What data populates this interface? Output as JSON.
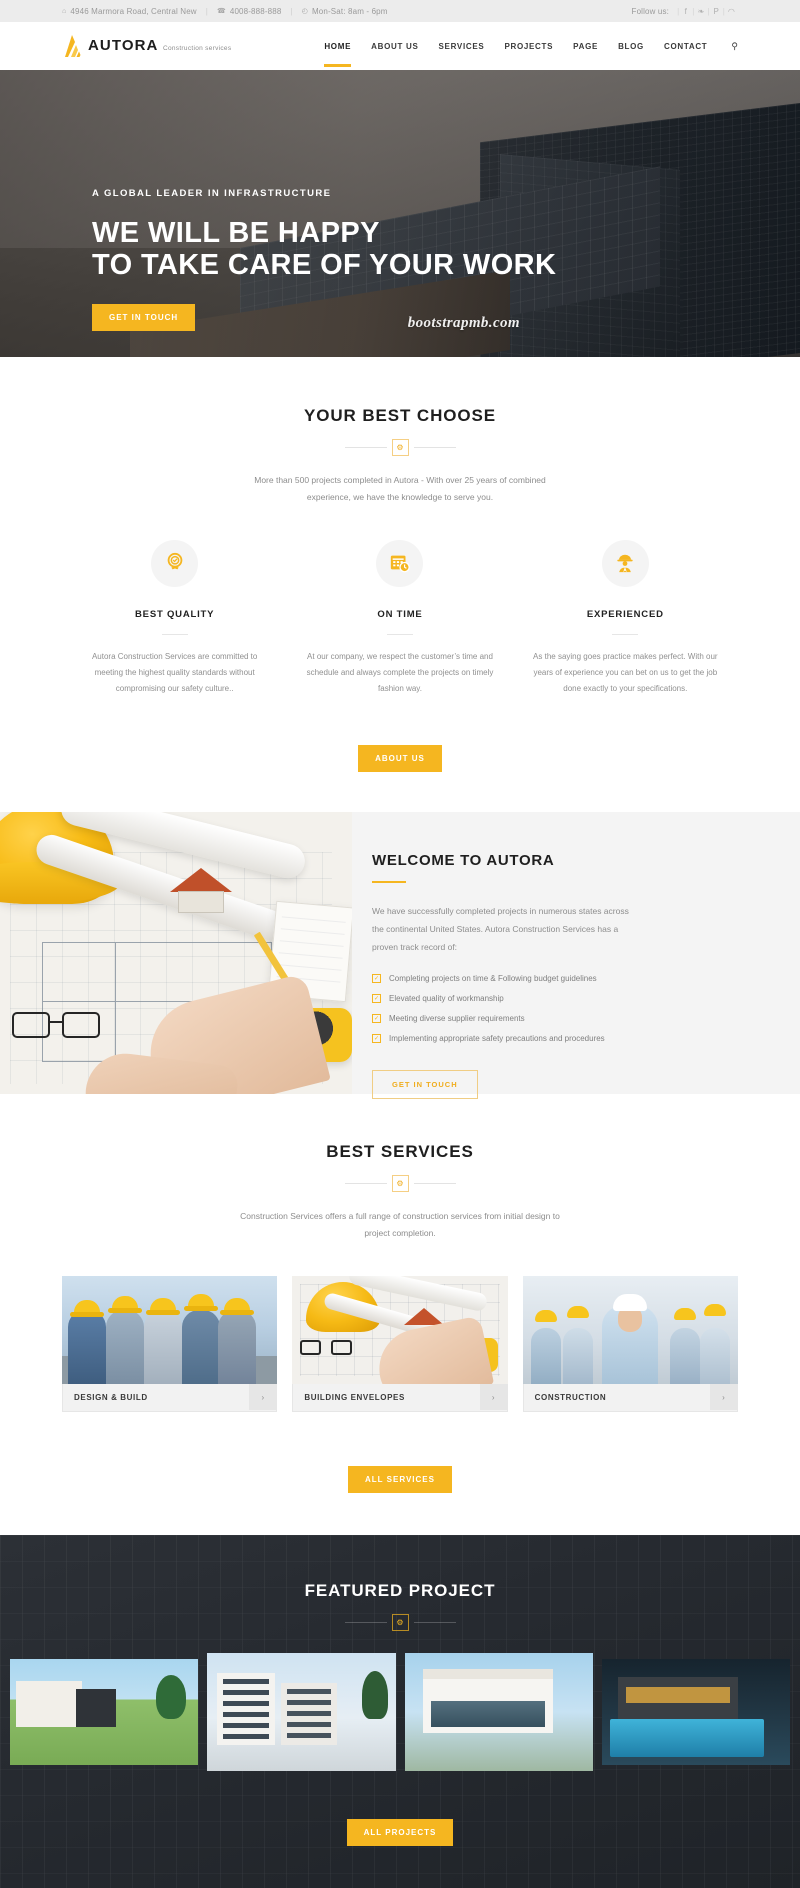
{
  "topbar": {
    "address": "4946 Marmora Road, Central New",
    "phone": "4008-888-888",
    "hours": "Mon-Sat: 8am - 6pm",
    "follow_label": "Follow us:",
    "socials": [
      {
        "name": "facebook-icon",
        "glyph": "f"
      },
      {
        "name": "twitter-icon",
        "glyph": "❧"
      },
      {
        "name": "pinterest-icon",
        "glyph": "P"
      },
      {
        "name": "rss-icon",
        "glyph": "◠"
      }
    ],
    "icons": {
      "address": "⌂",
      "phone": "☎",
      "clock": "◴"
    }
  },
  "header": {
    "brand": "AUTORA",
    "tagline": "Construction services",
    "nav": [
      {
        "label": "HOME",
        "active": true
      },
      {
        "label": "ABOUT US",
        "active": false
      },
      {
        "label": "SERVICES",
        "active": false
      },
      {
        "label": "PROJECTS",
        "active": false
      },
      {
        "label": "PAGE",
        "active": false
      },
      {
        "label": "BLOG",
        "active": false
      },
      {
        "label": "CONTACT",
        "active": false
      }
    ],
    "search_icon": "⚲"
  },
  "hero": {
    "kicker": "A GLOBAL LEADER IN INFRASTRUCTURE",
    "title_line1": "WE WILL BE HAPPY",
    "title_line2": "TO TAKE CARE OF YOUR WORK",
    "cta": "GET IN TOUCH",
    "watermark": "bootstrapmb.com"
  },
  "choose": {
    "title": "YOUR BEST CHOOSE",
    "divider_icon": "⚙",
    "subtitle": "More than 500 projects completed in Autora - With over 25 years of combined experience, we have the knowledge to serve you.",
    "features": [
      {
        "icon": "badge-award-icon",
        "title": "BEST QUALITY",
        "text": "Autora Construction Services are committed to meeting the highest quality standards without compromising our safety culture.."
      },
      {
        "icon": "calendar-clock-icon",
        "title": "ON TIME",
        "text": "At our company, we respect the customer’s time and schedule and always complete the projects on timely fashion way."
      },
      {
        "icon": "worker-helmet-icon",
        "title": "EXPERIENCED",
        "text": "As the saying goes practice makes perfect. With our years of experience you can bet on us to get the job done exactly to your specifications."
      }
    ],
    "cta": "ABOUT US"
  },
  "welcome": {
    "title": "WELCOME TO AUTORA",
    "text": "We have successfully completed projects in numerous states across the continental United States. Autora Construction Services has a proven track record of:",
    "list": [
      "Completing projects on time & Following budget guidelines",
      "Elevated quality of workmanship",
      "Meeting diverse supplier requirements",
      "Implementing appropriate safety precautions and procedures"
    ],
    "check_glyph": "✓",
    "cta": "GET IN TOUCH"
  },
  "services": {
    "title": "BEST SERVICES",
    "divider_icon": "⚙",
    "subtitle": "Construction Services offers a full range of construction services from initial design to project completion.",
    "cards": [
      {
        "name": "DESIGN & BUILD",
        "arrow": "›"
      },
      {
        "name": "BUILDING ENVELOPES",
        "arrow": "›"
      },
      {
        "name": "CONSTRUCTION",
        "arrow": "›"
      }
    ],
    "cta": "ALL SERVICES"
  },
  "featured": {
    "title": "FEATURED PROJECT",
    "divider_icon": "⚙",
    "projects": [
      {
        "name": "project-villa-garden"
      },
      {
        "name": "project-modern-apartments"
      },
      {
        "name": "project-white-house"
      },
      {
        "name": "project-pool-residence"
      }
    ],
    "cta": "ALL PROJECTS"
  },
  "colors": {
    "accent": "#f5b620",
    "dark": "#1f2328",
    "text": "#8d8d8d"
  }
}
